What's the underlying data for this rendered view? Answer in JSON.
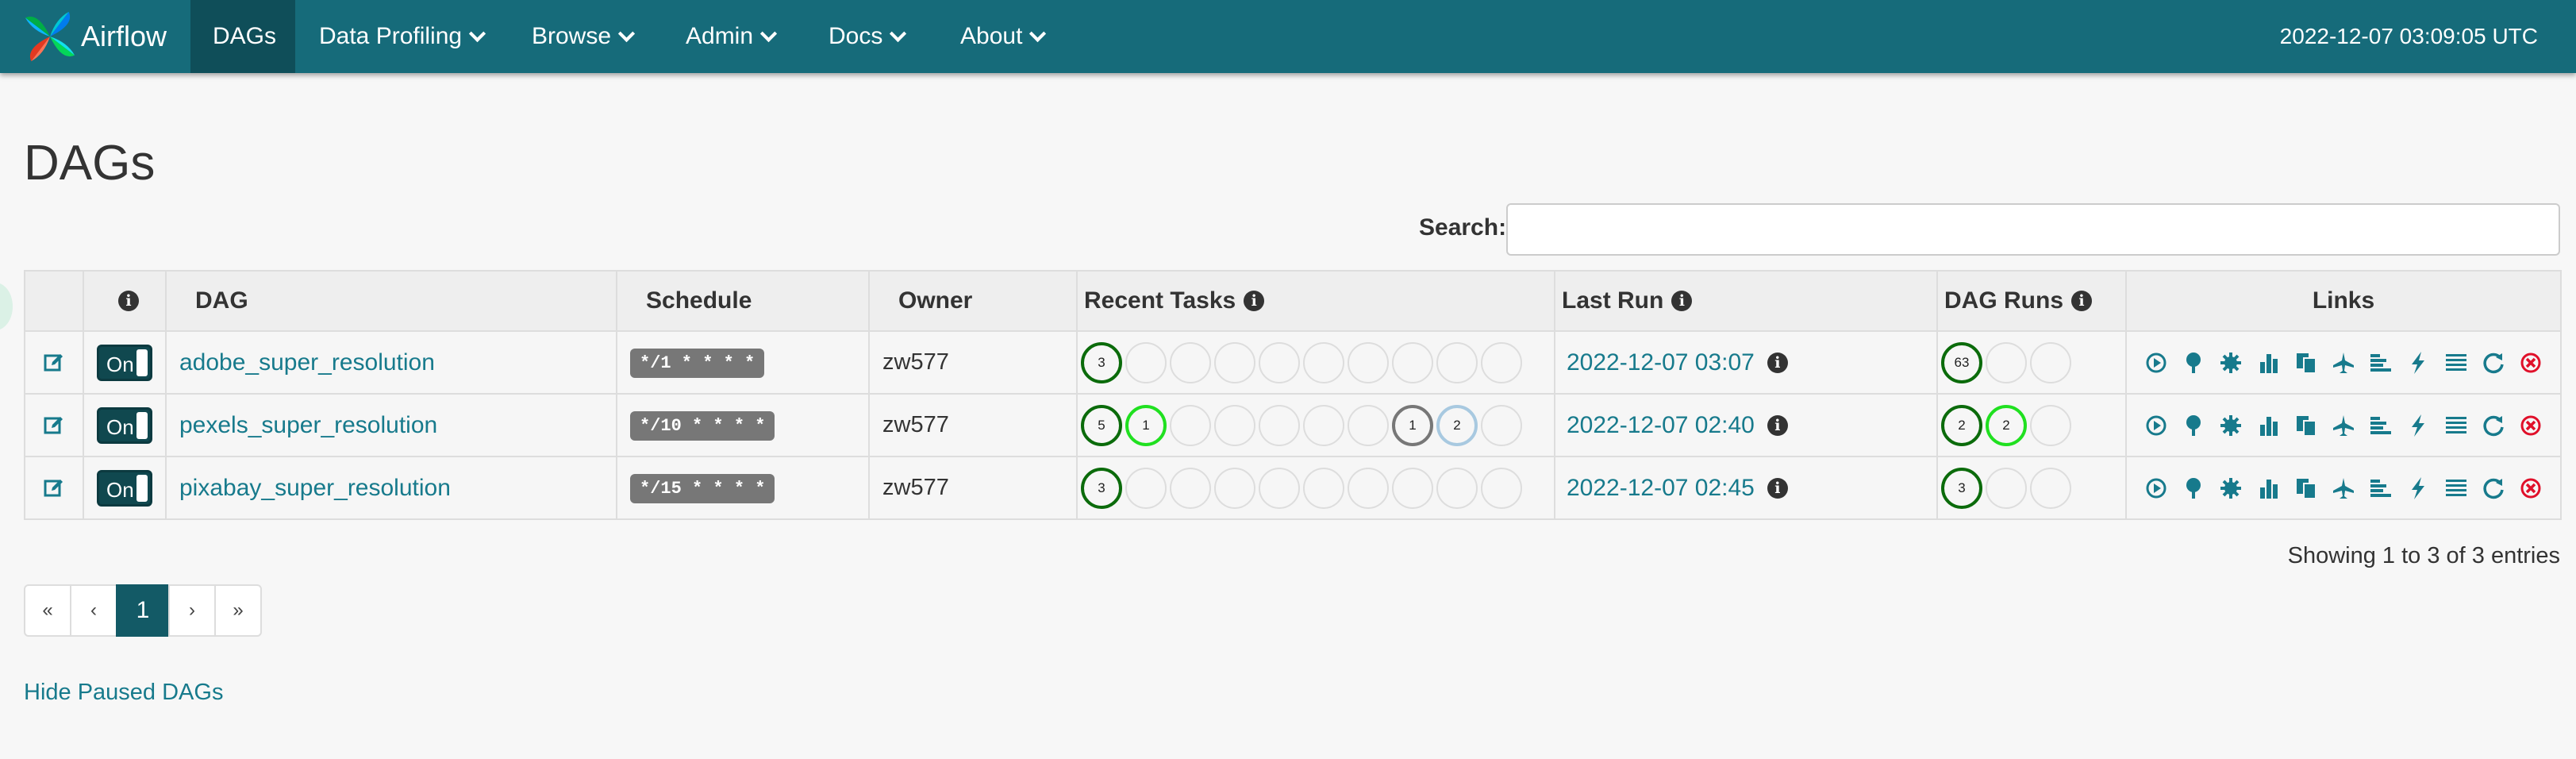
{
  "navbar": {
    "brand": "Airflow",
    "items": [
      {
        "label": "DAGs",
        "active": true,
        "dropdown": false
      },
      {
        "label": "Data Profiling",
        "dropdown": true
      },
      {
        "label": "Browse",
        "dropdown": true
      },
      {
        "label": "Admin",
        "dropdown": true
      },
      {
        "label": "Docs",
        "dropdown": true
      },
      {
        "label": "About",
        "dropdown": true
      }
    ],
    "time": "2022-12-07 03:09:05 UTC"
  },
  "page": {
    "title": "DAGs",
    "search_label": "Search:",
    "search_value": ""
  },
  "table": {
    "headers": {
      "info": "",
      "dag": "DAG",
      "schedule": "Schedule",
      "owner": "Owner",
      "recent_tasks": "Recent Tasks",
      "last_run": "Last Run",
      "dag_runs": "DAG Runs",
      "links": "Links"
    },
    "rows": [
      {
        "toggle": "On",
        "dag": "adobe_super_resolution",
        "schedule": "*/1 * * * *",
        "owner": "zw577",
        "recent_tasks": [
          "3",
          "",
          "",
          "",
          "",
          "",
          "",
          "",
          "",
          ""
        ],
        "last_run": "2022-12-07 03:07",
        "dag_runs": [
          "63",
          "",
          ""
        ]
      },
      {
        "toggle": "On",
        "dag": "pexels_super_resolution",
        "schedule": "*/10 * * * *",
        "owner": "zw577",
        "recent_tasks": [
          "5",
          "1",
          "",
          "",
          "",
          "",
          "",
          "1",
          "2",
          ""
        ],
        "last_run": "2022-12-07 02:40",
        "dag_runs": [
          "2",
          "2",
          ""
        ]
      },
      {
        "toggle": "On",
        "dag": "pixabay_super_resolution",
        "schedule": "*/15 * * * *",
        "owner": "zw577",
        "recent_tasks": [
          "3",
          "",
          "",
          "",
          "",
          "",
          "",
          "",
          "",
          ""
        ],
        "last_run": "2022-12-07 02:45",
        "dag_runs": [
          "3",
          "",
          ""
        ]
      }
    ]
  },
  "entries_info": "Showing 1 to 3 of 3 entries",
  "pagination": {
    "first": "«",
    "prev": "‹",
    "current": "1",
    "next": "›",
    "last": "»"
  },
  "hide_paused": "Hide Paused DAGs",
  "colors": {
    "navbar": "#166b7a",
    "link": "#177a8c",
    "success": "#0b6b0b",
    "running": "#20e020",
    "upstream_failed": "#777777",
    "queued": "#a8c9e0",
    "failed": "#e0102a"
  },
  "icons": {
    "edit": "edit-icon",
    "info": "info-icon",
    "links": [
      "trigger-dag-icon",
      "tree-view-icon",
      "graph-view-icon",
      "duration-chart-icon",
      "task-tries-icon",
      "landing-times-icon",
      "gantt-icon",
      "code-icon",
      "logs-icon",
      "refresh-icon",
      "delete-icon"
    ]
  }
}
